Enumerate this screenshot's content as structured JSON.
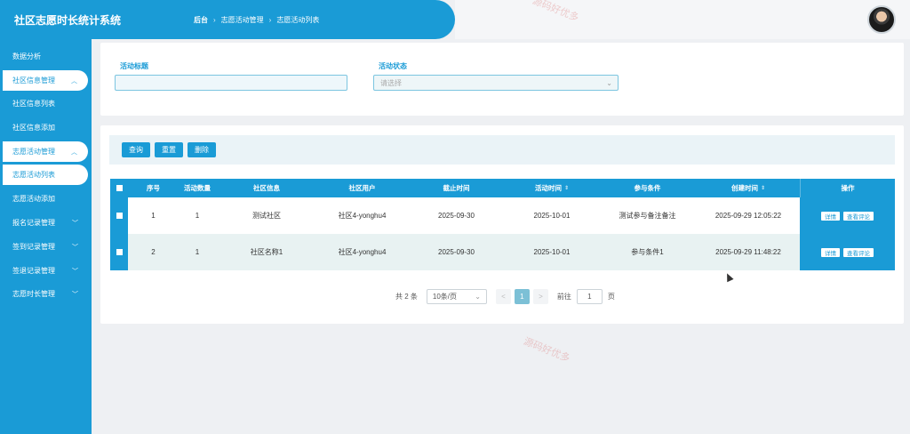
{
  "app": {
    "title": "社区志愿时长统计系统"
  },
  "breadcrumb": [
    "后台",
    "志愿活动管理",
    "志愿活动列表"
  ],
  "sidebar": {
    "items": [
      {
        "label": "数据分析",
        "chevron": ""
      },
      {
        "label": "社区信息管理",
        "chevron": "^"
      },
      {
        "label": "社区信息列表",
        "chevron": ""
      },
      {
        "label": "社区信息添加",
        "chevron": ""
      },
      {
        "label": "志愿活动管理",
        "chevron": "^"
      },
      {
        "label": "志愿活动列表",
        "chevron": ""
      },
      {
        "label": "志愿活动添加",
        "chevron": ""
      },
      {
        "label": "报名记录管理",
        "chevron": "v"
      },
      {
        "label": "签到记录管理",
        "chevron": "v"
      },
      {
        "label": "签退记录管理",
        "chevron": "v"
      },
      {
        "label": "志愿时长管理",
        "chevron": "v"
      }
    ]
  },
  "search": {
    "title_label": "活动标题",
    "title_value": "",
    "status_label": "活动状态",
    "status_placeholder": "请选择"
  },
  "toolbar": {
    "query": "查询",
    "reset": "重置",
    "delete": "删除"
  },
  "table": {
    "headers": [
      "序号",
      "活动数量",
      "社区信息",
      "社区用户",
      "截止时间",
      "活动时间",
      "参与条件",
      "创建时间",
      "操作"
    ],
    "rows": [
      {
        "index": "1",
        "count": "1",
        "community": "测试社区",
        "user": "社区4-yonghu4",
        "deadline": "2025-09-30",
        "activity_time": "2025-10-01",
        "condition": "测试参与备注备注",
        "created": "2025-09-29 12:05:22"
      },
      {
        "index": "2",
        "count": "1",
        "community": "社区名称1",
        "user": "社区4-yonghu4",
        "deadline": "2025-09-30",
        "activity_time": "2025-10-01",
        "condition": "参与条件1",
        "created": "2025-09-29 11:48:22"
      }
    ],
    "op_detail": "详情",
    "op_comment": "查看评论"
  },
  "pagination": {
    "total": "共 2 条",
    "page_size": "10条/页",
    "prev": "<",
    "current": "1",
    "next": ">",
    "goto_label": "前往",
    "goto_value": "1",
    "page_suffix": "页"
  },
  "watermark": "源码好优多",
  "colors": {
    "primary": "#1a9bd6",
    "row_alt": "#e8f2f2"
  }
}
